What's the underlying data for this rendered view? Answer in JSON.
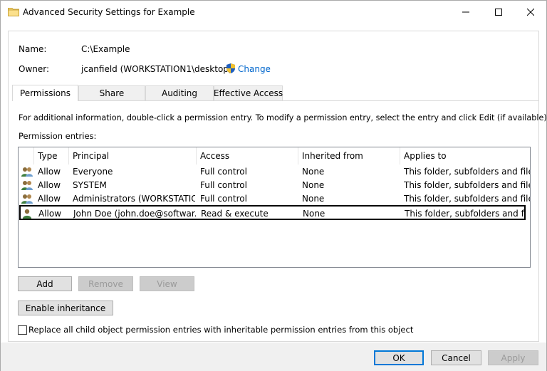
{
  "window": {
    "title": "Advanced Security Settings for Example",
    "controls": {
      "minimize": "minimize",
      "maximize": "maximize",
      "close": "close"
    }
  },
  "info": {
    "name_label": "Name:",
    "name_value": "C:\\Example",
    "owner_label": "Owner:",
    "owner_value": "jcanfield (WORKSTATION1\\desktop)",
    "change_link": "Change"
  },
  "tabs": [
    {
      "label": "Permissions",
      "active": true
    },
    {
      "label": "Share",
      "active": false
    },
    {
      "label": "Auditing",
      "active": false
    },
    {
      "label": "Effective Access",
      "active": false
    }
  ],
  "permissions": {
    "description": "For additional information, double-click a permission entry. To modify a permission entry, select the entry and click Edit (if available).",
    "entries_label": "Permission entries:",
    "columns": [
      "Type",
      "Principal",
      "Access",
      "Inherited from",
      "Applies to"
    ],
    "rows": [
      {
        "icon": "group-users-icon",
        "type": "Allow",
        "principal": "Everyone",
        "access": "Full control",
        "inherited": "None",
        "applies": "This folder, subfolders and files"
      },
      {
        "icon": "group-users-icon",
        "type": "Allow",
        "principal": "SYSTEM",
        "access": "Full control",
        "inherited": "None",
        "applies": "This folder, subfolders and files"
      },
      {
        "icon": "group-users-icon",
        "type": "Allow",
        "principal": "Administrators (WORKSTATIO...",
        "access": "Full control",
        "inherited": "None",
        "applies": "This folder, subfolders and files"
      },
      {
        "icon": "user-icon",
        "type": "Allow",
        "principal": "John Doe (john.doe@softwar...",
        "access": "Read & execute",
        "inherited": "None",
        "applies": "This folder, subfolders and files",
        "selected": true
      }
    ]
  },
  "buttons": {
    "add": "Add",
    "remove": "Remove",
    "view": "View",
    "enable_inheritance": "Enable inheritance"
  },
  "replace_checkbox": {
    "label": "Replace all child object permission entries with inheritable permission entries from this object",
    "checked": false
  },
  "footer": {
    "ok": "OK",
    "cancel": "Cancel",
    "apply": "Apply"
  },
  "colors": {
    "link": "#0066cc",
    "accent": "#0078d7",
    "disabled_text": "#9a9a9a"
  }
}
